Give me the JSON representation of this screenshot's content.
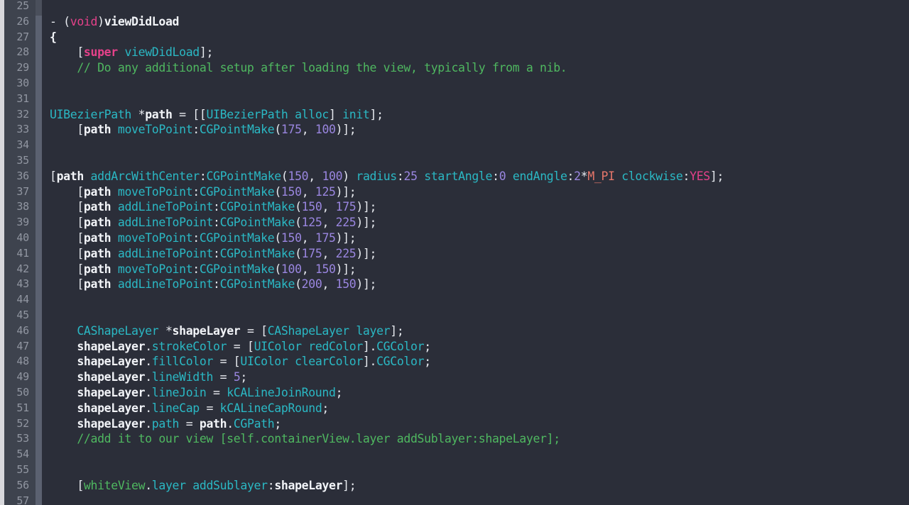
{
  "editor": {
    "theme_name": "dark-objc",
    "colors": {
      "background": "#2b2e39",
      "gutter_background": "#3e434e",
      "gutter_text": "#9196a1",
      "separator": "#5b6170",
      "edge_strip": "#d8d8dc",
      "plain_text": "#e8ebf0",
      "keyword": "#e5418a",
      "type": "#2bb8c4",
      "method": "#2bb8c4",
      "number": "#9a86e0",
      "comment": "#4fb860",
      "constant": "#e8776b",
      "variable": "#4fb860"
    },
    "first_line": 25,
    "last_line": 57,
    "language": "Objective-C"
  },
  "lines": [
    {
      "num": "25",
      "tokens": []
    },
    {
      "num": "26",
      "tokens": [
        {
          "t": "- (",
          "c": "t-plain"
        },
        {
          "t": "void",
          "c": "t-kw"
        },
        {
          "t": ")",
          "c": "t-plain"
        },
        {
          "t": "viewDidLoad",
          "c": "t-ident"
        }
      ]
    },
    {
      "num": "27",
      "tokens": [
        {
          "t": "{",
          "c": "t-ident"
        }
      ]
    },
    {
      "num": "28",
      "tokens": [
        {
          "t": "    [",
          "c": "t-plain"
        },
        {
          "t": "super",
          "c": "t-kw2"
        },
        {
          "t": " ",
          "c": "t-plain"
        },
        {
          "t": "viewDidLoad",
          "c": "t-method"
        },
        {
          "t": "];",
          "c": "t-plain"
        }
      ]
    },
    {
      "num": "29",
      "tokens": [
        {
          "t": "    // Do any additional setup after loading the view, typically from a nib.",
          "c": "t-comment"
        }
      ]
    },
    {
      "num": "30",
      "tokens": []
    },
    {
      "num": "31",
      "tokens": []
    },
    {
      "num": "32",
      "tokens": [
        {
          "t": "UIBezierPath",
          "c": "t-type"
        },
        {
          "t": " *",
          "c": "t-plain"
        },
        {
          "t": "path",
          "c": "t-ident"
        },
        {
          "t": " = [[",
          "c": "t-plain"
        },
        {
          "t": "UIBezierPath",
          "c": "t-type"
        },
        {
          "t": " ",
          "c": "t-plain"
        },
        {
          "t": "alloc",
          "c": "t-method"
        },
        {
          "t": "] ",
          "c": "t-plain"
        },
        {
          "t": "init",
          "c": "t-method"
        },
        {
          "t": "];",
          "c": "t-plain"
        }
      ]
    },
    {
      "num": "33",
      "tokens": [
        {
          "t": "    [",
          "c": "t-plain"
        },
        {
          "t": "path",
          "c": "t-ident"
        },
        {
          "t": " ",
          "c": "t-plain"
        },
        {
          "t": "moveToPoint",
          "c": "t-method"
        },
        {
          "t": ":",
          "c": "t-plain"
        },
        {
          "t": "CGPointMake",
          "c": "t-type"
        },
        {
          "t": "(",
          "c": "t-plain"
        },
        {
          "t": "175",
          "c": "t-num"
        },
        {
          "t": ", ",
          "c": "t-plain"
        },
        {
          "t": "100",
          "c": "t-num"
        },
        {
          "t": ")];",
          "c": "t-plain"
        }
      ]
    },
    {
      "num": "34",
      "tokens": []
    },
    {
      "num": "35",
      "tokens": []
    },
    {
      "num": "36",
      "tokens": [
        {
          "t": "[",
          "c": "t-plain"
        },
        {
          "t": "path",
          "c": "t-ident"
        },
        {
          "t": " ",
          "c": "t-plain"
        },
        {
          "t": "addArcWithCenter",
          "c": "t-method"
        },
        {
          "t": ":",
          "c": "t-plain"
        },
        {
          "t": "CGPointMake",
          "c": "t-type"
        },
        {
          "t": "(",
          "c": "t-plain"
        },
        {
          "t": "150",
          "c": "t-num"
        },
        {
          "t": ", ",
          "c": "t-plain"
        },
        {
          "t": "100",
          "c": "t-num"
        },
        {
          "t": ") ",
          "c": "t-plain"
        },
        {
          "t": "radius",
          "c": "t-method"
        },
        {
          "t": ":",
          "c": "t-plain"
        },
        {
          "t": "25",
          "c": "t-num"
        },
        {
          "t": " ",
          "c": "t-plain"
        },
        {
          "t": "startAngle",
          "c": "t-method"
        },
        {
          "t": ":",
          "c": "t-plain"
        },
        {
          "t": "0",
          "c": "t-num"
        },
        {
          "t": " ",
          "c": "t-plain"
        },
        {
          "t": "endAngle",
          "c": "t-method"
        },
        {
          "t": ":",
          "c": "t-plain"
        },
        {
          "t": "2",
          "c": "t-num"
        },
        {
          "t": "*",
          "c": "t-plain"
        },
        {
          "t": "M_PI",
          "c": "t-const"
        },
        {
          "t": " ",
          "c": "t-plain"
        },
        {
          "t": "clockwise",
          "c": "t-method"
        },
        {
          "t": ":",
          "c": "t-plain"
        },
        {
          "t": "YES",
          "c": "t-bool"
        },
        {
          "t": "];",
          "c": "t-plain"
        }
      ]
    },
    {
      "num": "37",
      "tokens": [
        {
          "t": "    [",
          "c": "t-plain"
        },
        {
          "t": "path",
          "c": "t-ident"
        },
        {
          "t": " ",
          "c": "t-plain"
        },
        {
          "t": "moveToPoint",
          "c": "t-method"
        },
        {
          "t": ":",
          "c": "t-plain"
        },
        {
          "t": "CGPointMake",
          "c": "t-type"
        },
        {
          "t": "(",
          "c": "t-plain"
        },
        {
          "t": "150",
          "c": "t-num"
        },
        {
          "t": ", ",
          "c": "t-plain"
        },
        {
          "t": "125",
          "c": "t-num"
        },
        {
          "t": ")];",
          "c": "t-plain"
        }
      ]
    },
    {
      "num": "38",
      "tokens": [
        {
          "t": "    [",
          "c": "t-plain"
        },
        {
          "t": "path",
          "c": "t-ident"
        },
        {
          "t": " ",
          "c": "t-plain"
        },
        {
          "t": "addLineToPoint",
          "c": "t-method"
        },
        {
          "t": ":",
          "c": "t-plain"
        },
        {
          "t": "CGPointMake",
          "c": "t-type"
        },
        {
          "t": "(",
          "c": "t-plain"
        },
        {
          "t": "150",
          "c": "t-num"
        },
        {
          "t": ", ",
          "c": "t-plain"
        },
        {
          "t": "175",
          "c": "t-num"
        },
        {
          "t": ")];",
          "c": "t-plain"
        }
      ]
    },
    {
      "num": "39",
      "tokens": [
        {
          "t": "    [",
          "c": "t-plain"
        },
        {
          "t": "path",
          "c": "t-ident"
        },
        {
          "t": " ",
          "c": "t-plain"
        },
        {
          "t": "addLineToPoint",
          "c": "t-method"
        },
        {
          "t": ":",
          "c": "t-plain"
        },
        {
          "t": "CGPointMake",
          "c": "t-type"
        },
        {
          "t": "(",
          "c": "t-plain"
        },
        {
          "t": "125",
          "c": "t-num"
        },
        {
          "t": ", ",
          "c": "t-plain"
        },
        {
          "t": "225",
          "c": "t-num"
        },
        {
          "t": ")];",
          "c": "t-plain"
        }
      ]
    },
    {
      "num": "40",
      "tokens": [
        {
          "t": "    [",
          "c": "t-plain"
        },
        {
          "t": "path",
          "c": "t-ident"
        },
        {
          "t": " ",
          "c": "t-plain"
        },
        {
          "t": "moveToPoint",
          "c": "t-method"
        },
        {
          "t": ":",
          "c": "t-plain"
        },
        {
          "t": "CGPointMake",
          "c": "t-type"
        },
        {
          "t": "(",
          "c": "t-plain"
        },
        {
          "t": "150",
          "c": "t-num"
        },
        {
          "t": ", ",
          "c": "t-plain"
        },
        {
          "t": "175",
          "c": "t-num"
        },
        {
          "t": ")];",
          "c": "t-plain"
        }
      ]
    },
    {
      "num": "41",
      "tokens": [
        {
          "t": "    [",
          "c": "t-plain"
        },
        {
          "t": "path",
          "c": "t-ident"
        },
        {
          "t": " ",
          "c": "t-plain"
        },
        {
          "t": "addLineToPoint",
          "c": "t-method"
        },
        {
          "t": ":",
          "c": "t-plain"
        },
        {
          "t": "CGPointMake",
          "c": "t-type"
        },
        {
          "t": "(",
          "c": "t-plain"
        },
        {
          "t": "175",
          "c": "t-num"
        },
        {
          "t": ", ",
          "c": "t-plain"
        },
        {
          "t": "225",
          "c": "t-num"
        },
        {
          "t": ")];",
          "c": "t-plain"
        }
      ]
    },
    {
      "num": "42",
      "tokens": [
        {
          "t": "    [",
          "c": "t-plain"
        },
        {
          "t": "path",
          "c": "t-ident"
        },
        {
          "t": " ",
          "c": "t-plain"
        },
        {
          "t": "moveToPoint",
          "c": "t-method"
        },
        {
          "t": ":",
          "c": "t-plain"
        },
        {
          "t": "CGPointMake",
          "c": "t-type"
        },
        {
          "t": "(",
          "c": "t-plain"
        },
        {
          "t": "100",
          "c": "t-num"
        },
        {
          "t": ", ",
          "c": "t-plain"
        },
        {
          "t": "150",
          "c": "t-num"
        },
        {
          "t": ")];",
          "c": "t-plain"
        }
      ]
    },
    {
      "num": "43",
      "tokens": [
        {
          "t": "    [",
          "c": "t-plain"
        },
        {
          "t": "path",
          "c": "t-ident"
        },
        {
          "t": " ",
          "c": "t-plain"
        },
        {
          "t": "addLineToPoint",
          "c": "t-method"
        },
        {
          "t": ":",
          "c": "t-plain"
        },
        {
          "t": "CGPointMake",
          "c": "t-type"
        },
        {
          "t": "(",
          "c": "t-plain"
        },
        {
          "t": "200",
          "c": "t-num"
        },
        {
          "t": ", ",
          "c": "t-plain"
        },
        {
          "t": "150",
          "c": "t-num"
        },
        {
          "t": ")];",
          "c": "t-plain"
        }
      ]
    },
    {
      "num": "44",
      "tokens": []
    },
    {
      "num": "45",
      "tokens": []
    },
    {
      "num": "46",
      "tokens": [
        {
          "t": "    ",
          "c": "t-plain"
        },
        {
          "t": "CAShapeLayer",
          "c": "t-type"
        },
        {
          "t": " *",
          "c": "t-plain"
        },
        {
          "t": "shapeLayer",
          "c": "t-ident"
        },
        {
          "t": " = [",
          "c": "t-plain"
        },
        {
          "t": "CAShapeLayer",
          "c": "t-type"
        },
        {
          "t": " ",
          "c": "t-plain"
        },
        {
          "t": "layer",
          "c": "t-method"
        },
        {
          "t": "];",
          "c": "t-plain"
        }
      ]
    },
    {
      "num": "47",
      "tokens": [
        {
          "t": "    ",
          "c": "t-plain"
        },
        {
          "t": "shapeLayer",
          "c": "t-ident"
        },
        {
          "t": ".",
          "c": "t-plain"
        },
        {
          "t": "strokeColor",
          "c": "t-prop"
        },
        {
          "t": " = [",
          "c": "t-plain"
        },
        {
          "t": "UIColor",
          "c": "t-type"
        },
        {
          "t": " ",
          "c": "t-plain"
        },
        {
          "t": "redColor",
          "c": "t-method"
        },
        {
          "t": "].",
          "c": "t-plain"
        },
        {
          "t": "CGColor",
          "c": "t-prop"
        },
        {
          "t": ";",
          "c": "t-plain"
        }
      ]
    },
    {
      "num": "48",
      "tokens": [
        {
          "t": "    ",
          "c": "t-plain"
        },
        {
          "t": "shapeLayer",
          "c": "t-ident"
        },
        {
          "t": ".",
          "c": "t-plain"
        },
        {
          "t": "fillColor",
          "c": "t-prop"
        },
        {
          "t": " = [",
          "c": "t-plain"
        },
        {
          "t": "UIColor",
          "c": "t-type"
        },
        {
          "t": " ",
          "c": "t-plain"
        },
        {
          "t": "clearColor",
          "c": "t-method"
        },
        {
          "t": "].",
          "c": "t-plain"
        },
        {
          "t": "CGColor",
          "c": "t-prop"
        },
        {
          "t": ";",
          "c": "t-plain"
        }
      ]
    },
    {
      "num": "49",
      "tokens": [
        {
          "t": "    ",
          "c": "t-plain"
        },
        {
          "t": "shapeLayer",
          "c": "t-ident"
        },
        {
          "t": ".",
          "c": "t-plain"
        },
        {
          "t": "lineWidth",
          "c": "t-prop"
        },
        {
          "t": " = ",
          "c": "t-plain"
        },
        {
          "t": "5",
          "c": "t-num"
        },
        {
          "t": ";",
          "c": "t-plain"
        }
      ]
    },
    {
      "num": "50",
      "tokens": [
        {
          "t": "    ",
          "c": "t-plain"
        },
        {
          "t": "shapeLayer",
          "c": "t-ident"
        },
        {
          "t": ".",
          "c": "t-plain"
        },
        {
          "t": "lineJoin",
          "c": "t-prop"
        },
        {
          "t": " = ",
          "c": "t-plain"
        },
        {
          "t": "kCALineJoinRound",
          "c": "t-type"
        },
        {
          "t": ";",
          "c": "t-plain"
        }
      ]
    },
    {
      "num": "51",
      "tokens": [
        {
          "t": "    ",
          "c": "t-plain"
        },
        {
          "t": "shapeLayer",
          "c": "t-ident"
        },
        {
          "t": ".",
          "c": "t-plain"
        },
        {
          "t": "lineCap",
          "c": "t-prop"
        },
        {
          "t": " = ",
          "c": "t-plain"
        },
        {
          "t": "kCALineCapRound",
          "c": "t-type"
        },
        {
          "t": ";",
          "c": "t-plain"
        }
      ]
    },
    {
      "num": "52",
      "tokens": [
        {
          "t": "    ",
          "c": "t-plain"
        },
        {
          "t": "shapeLayer",
          "c": "t-ident"
        },
        {
          "t": ".",
          "c": "t-plain"
        },
        {
          "t": "path",
          "c": "t-prop"
        },
        {
          "t": " = ",
          "c": "t-plain"
        },
        {
          "t": "path",
          "c": "t-ident"
        },
        {
          "t": ".",
          "c": "t-plain"
        },
        {
          "t": "CGPath",
          "c": "t-prop"
        },
        {
          "t": ";",
          "c": "t-plain"
        }
      ]
    },
    {
      "num": "53",
      "tokens": [
        {
          "t": "    //add it to our view [self.containerView.layer addSublayer:shapeLayer];",
          "c": "t-comment"
        }
      ]
    },
    {
      "num": "54",
      "tokens": []
    },
    {
      "num": "55",
      "tokens": []
    },
    {
      "num": "56",
      "tokens": [
        {
          "t": "    [",
          "c": "t-plain"
        },
        {
          "t": "whiteView",
          "c": "t-var"
        },
        {
          "t": ".",
          "c": "t-plain"
        },
        {
          "t": "layer",
          "c": "t-prop"
        },
        {
          "t": " ",
          "c": "t-plain"
        },
        {
          "t": "addSublayer",
          "c": "t-method"
        },
        {
          "t": ":",
          "c": "t-plain"
        },
        {
          "t": "shapeLayer",
          "c": "t-ident"
        },
        {
          "t": "];",
          "c": "t-plain"
        }
      ]
    },
    {
      "num": "57",
      "tokens": []
    }
  ]
}
